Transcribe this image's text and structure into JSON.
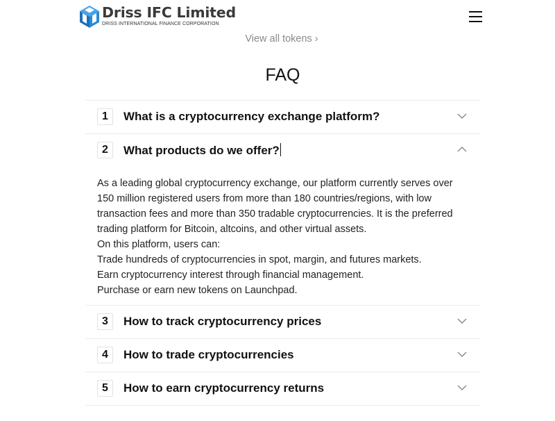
{
  "header": {
    "brand_name": "Driss IFC Limited",
    "brand_subtitle": "DRISS INTERNATIONAL FINANCE CORPORATION",
    "logo_icon": "cube-logo-icon",
    "menu_icon": "hamburger-menu-icon",
    "brand_color": "#1e88d8"
  },
  "view_all": {
    "label": "View all tokens",
    "chevron": "›"
  },
  "faq": {
    "title": "FAQ",
    "items": [
      {
        "number": "1",
        "question": "What is a cryptocurrency exchange platform?",
        "expanded": false
      },
      {
        "number": "2",
        "question": "What products do we offer?",
        "expanded": true,
        "answer": [
          "As a leading global cryptocurrency exchange, our platform currently serves over 150 million registered users from more than 180 countries/regions, with low transaction fees and more than 350 tradable cryptocurrencies. It is the preferred trading platform for Bitcoin, altcoins, and other virtual assets.",
          "On this platform, users can:",
          "Trade hundreds of cryptocurrencies in spot, margin, and futures markets.",
          "Earn cryptocurrency interest through financial management.",
          "Purchase or earn new tokens on Launchpad."
        ]
      },
      {
        "number": "3",
        "question": "How to track cryptocurrency prices",
        "expanded": false
      },
      {
        "number": "4",
        "question": "How to trade cryptocurrencies",
        "expanded": false
      },
      {
        "number": "5",
        "question": "How to earn cryptocurrency returns",
        "expanded": false
      }
    ]
  }
}
